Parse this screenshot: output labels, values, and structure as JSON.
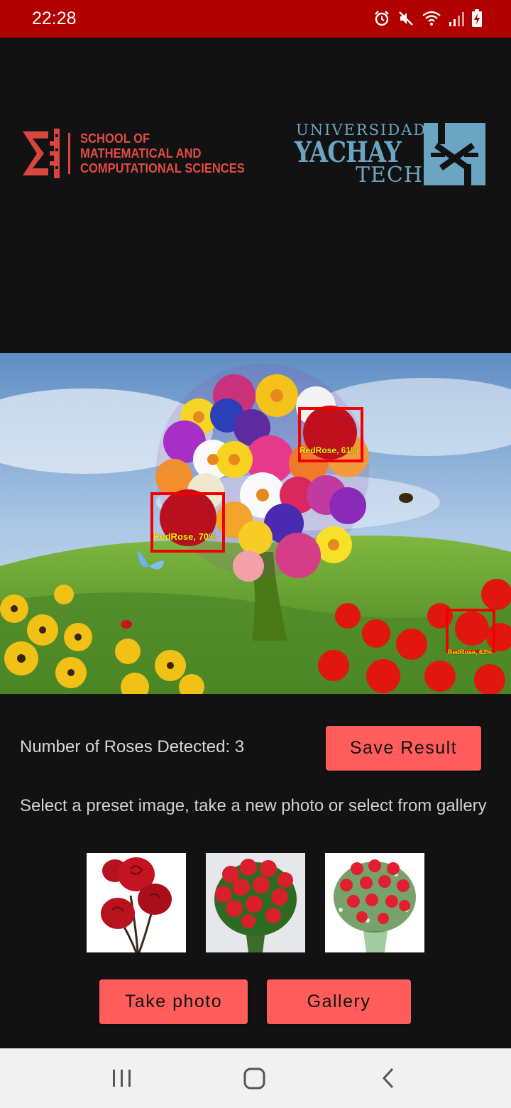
{
  "status_bar": {
    "time": "22:28",
    "icons": [
      "alarm-icon",
      "mute-icon",
      "wifi-icon",
      "signal-icon",
      "battery-charging-icon"
    ],
    "color": "#b00000"
  },
  "logos": {
    "smcs": {
      "lines": [
        "SCHOOL OF",
        "MATHEMATICAL AND",
        "COMPUTATIONAL SCIENCES"
      ],
      "color": "#e24b43"
    },
    "yachay": {
      "line1": "UNIVERSIDAD",
      "line2": "YACHAY",
      "line3": "TECH",
      "color": "#6aa6c1"
    }
  },
  "result": {
    "detections": [
      {
        "label": "RedRose, 61%"
      },
      {
        "label": "RedRose, 70%"
      },
      {
        "label": "RedRose, 63%"
      }
    ],
    "box_color": "#f20000",
    "label_color": "#ffee00"
  },
  "main": {
    "count_text": "Number of Roses Detected: 3",
    "save_button": "Save Result",
    "instruction": "Select a preset image, take a new photo or select from gallery",
    "take_photo_button": "Take photo",
    "gallery_button": "Gallery",
    "accent_color": "#ff5c5c"
  },
  "nav_bar": {
    "buttons": [
      "recent-apps-icon",
      "home-icon",
      "back-icon"
    ]
  }
}
